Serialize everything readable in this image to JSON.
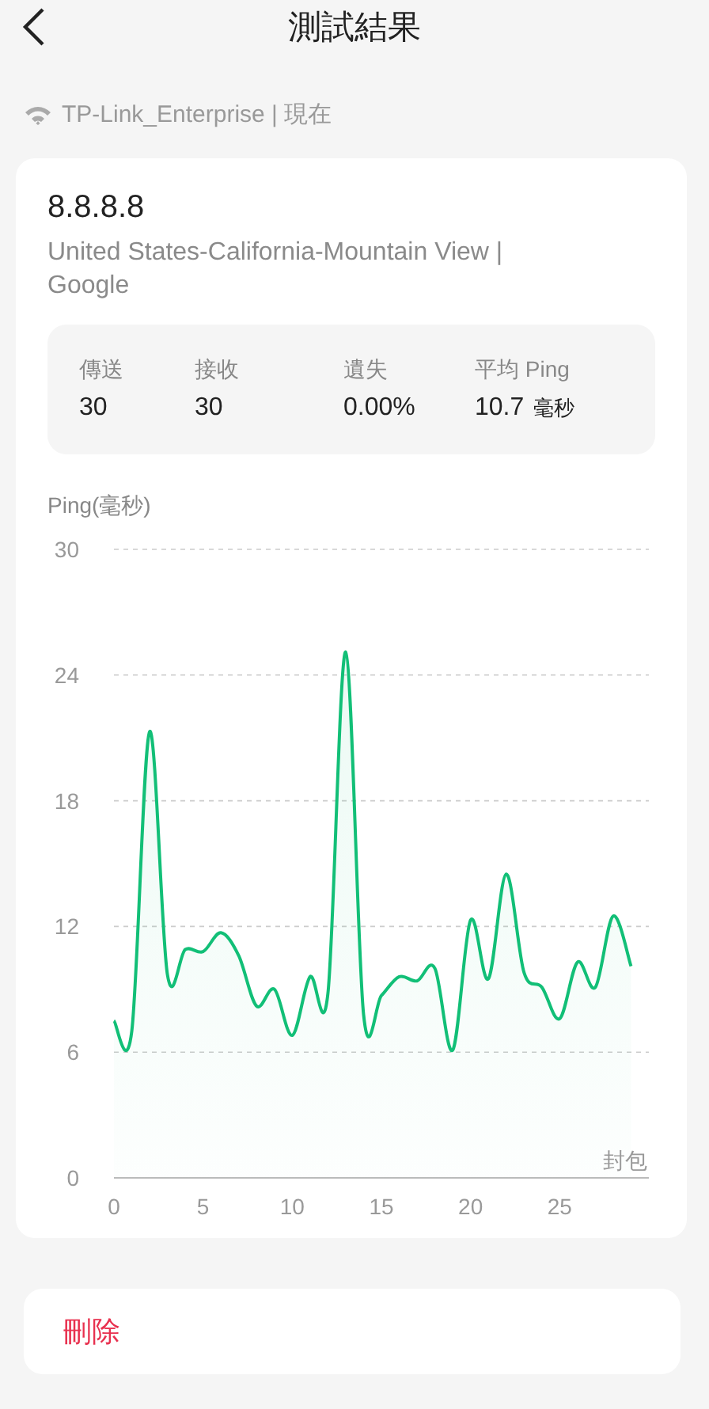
{
  "header": {
    "title": "測試結果"
  },
  "network": {
    "text": "TP-Link_Enterprise | 現在"
  },
  "result": {
    "host": "8.8.8.8",
    "location": "United States-California-Mountain View | Google",
    "stats": [
      {
        "label": "傳送",
        "value": "30"
      },
      {
        "label": "接收",
        "value": "30"
      },
      {
        "label": "遺失",
        "value": "0.00%"
      },
      {
        "label": "平均 Ping",
        "value": "10.7",
        "unit": "毫秒"
      }
    ],
    "chart_data": {
      "type": "area",
      "grid": true,
      "ylabel": "Ping(毫秒)",
      "xlabel": "封包",
      "x": [
        0,
        1,
        2,
        3,
        4,
        5,
        6,
        7,
        8,
        9,
        10,
        11,
        12,
        13,
        14,
        15,
        16,
        17,
        18,
        19,
        20,
        21,
        22,
        23,
        24,
        25,
        26,
        27,
        28,
        29
      ],
      "ylim": [
        0,
        30
      ],
      "xlim": [
        0,
        30
      ],
      "yticks": [
        0,
        6,
        12,
        18,
        24,
        30
      ],
      "xticks": [
        0,
        5,
        10,
        15,
        20,
        25
      ],
      "series": [
        {
          "color": "#12bf77",
          "values": [
            7.5,
            7.0,
            21.3,
            9.7,
            10.9,
            10.8,
            11.7,
            10.6,
            8.2,
            9.0,
            6.8,
            9.6,
            8.8,
            25.1,
            7.8,
            8.7,
            9.6,
            9.4,
            10.0,
            6.1,
            12.3,
            9.5,
            14.5,
            9.8,
            9.1,
            7.6,
            10.3,
            9.1,
            12.5,
            10.1
          ]
        }
      ]
    }
  },
  "delete_button": {
    "label": "刪除"
  }
}
